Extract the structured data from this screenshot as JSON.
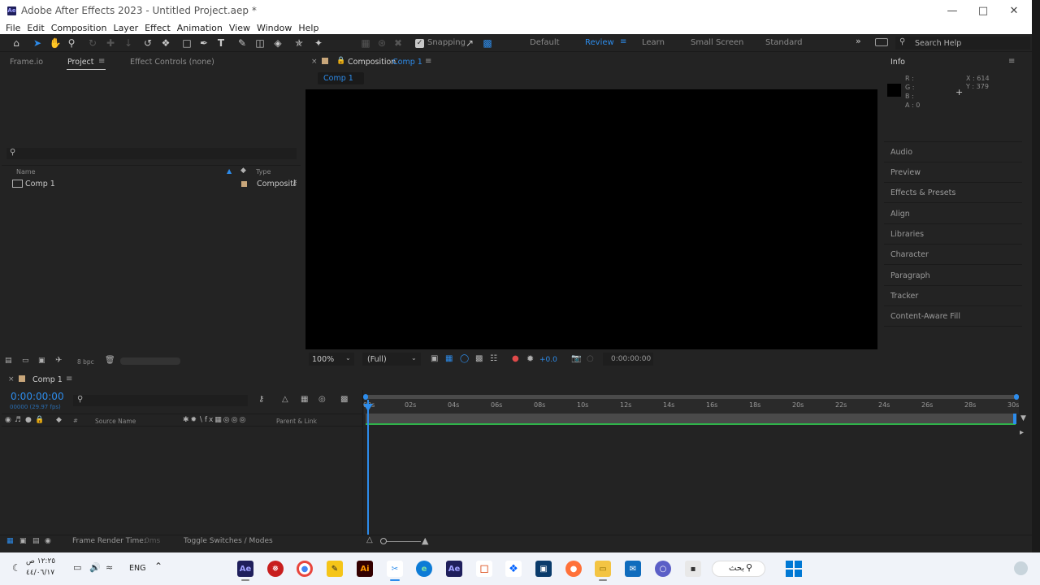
{
  "window": {
    "title": "Adobe After Effects 2023 - Untitled Project.aep *",
    "logo": "Ae"
  },
  "menu": [
    "File",
    "Edit",
    "Composition",
    "Layer",
    "Effect",
    "Animation",
    "View",
    "Window",
    "Help"
  ],
  "toolbar": {
    "snapping_label": "Snapping"
  },
  "workspaces": [
    "Default",
    "Review",
    "Learn",
    "Small Screen",
    "Standard"
  ],
  "active_workspace": "Review",
  "search_help": "Search Help",
  "project_panel": {
    "tabs": [
      "Frame.io",
      "Project",
      "Effect Controls (none)"
    ],
    "col_name": "Name",
    "col_type": "Type",
    "items": [
      {
        "name": "Comp 1",
        "type": "Compositi"
      }
    ],
    "bpc": "8 bpc"
  },
  "comp_panel": {
    "tab_prefix": "Composition",
    "tab_name": "Comp 1",
    "subtab": "Comp 1",
    "zoom": "100%",
    "resolution": "(Full)",
    "exposure": "+0.0",
    "timecode": "0:00:00:00"
  },
  "info_panel": {
    "title": "Info",
    "r": "R :",
    "g": "G :",
    "b": "B :",
    "a": "A : 0",
    "x": "X : 614",
    "y": "Y : 379"
  },
  "right_panels": [
    "Audio",
    "Preview",
    "Effects & Presets",
    "Align",
    "Libraries",
    "Character",
    "Paragraph",
    "Tracker",
    "Content-Aware Fill"
  ],
  "timeline": {
    "tab": "Comp 1",
    "timecode": "0:00:00:00",
    "fps": "00000 (29.97 fps)",
    "col_source": "Source Name",
    "col_parent": "Parent & Link",
    "col_hash": "#",
    "ticks": [
      "00s",
      "02s",
      "04s",
      "06s",
      "08s",
      "10s",
      "12s",
      "14s",
      "16s",
      "18s",
      "20s",
      "22s",
      "24s",
      "26s",
      "28s",
      "30s"
    ]
  },
  "status": {
    "render_label": "Frame Render Time:",
    "render_value": "0ms",
    "toggle": "Toggle Switches / Modes"
  },
  "taskbar": {
    "time": "١٢:٢٥ ص",
    "date": "٤٤/٠٦/١٧",
    "lang": "ENG",
    "search": "بحث"
  },
  "colors": {
    "accent": "#2d8ceb",
    "work_area": "#2fb34a"
  }
}
